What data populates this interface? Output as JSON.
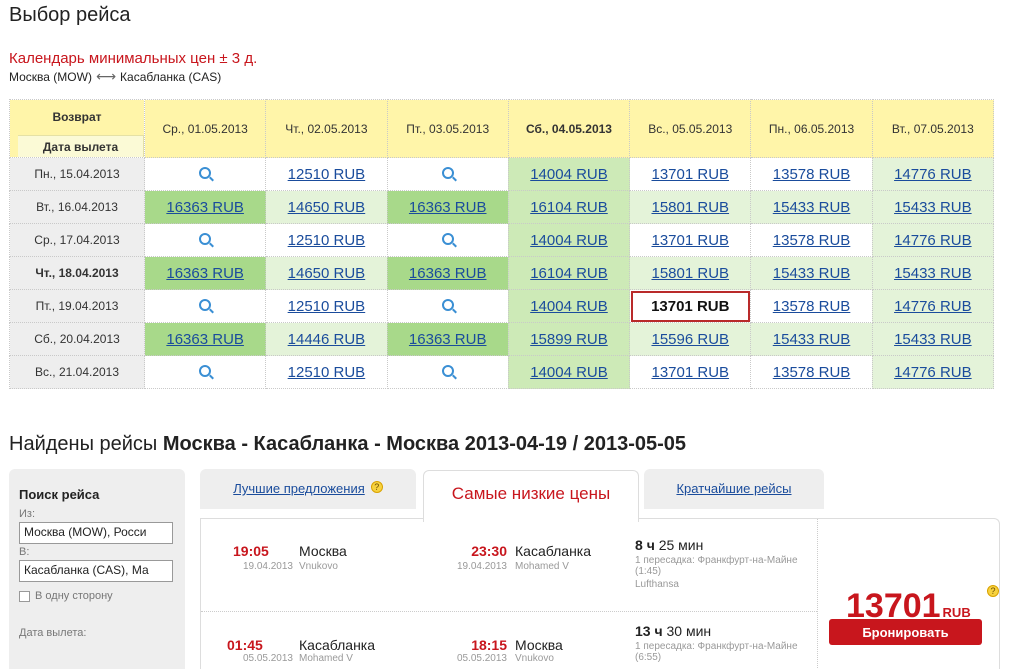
{
  "page_title": "Выбор рейса",
  "calendar": {
    "title": "Календарь минимальных цен ± 3 д.",
    "origin": "Москва (MOW)",
    "destination": "Касабланка (CAS)",
    "return_label": "Возврат",
    "departure_label": "Дата вылета",
    "return_dates": [
      "Ср., 01.05.2013",
      "Чт., 02.05.2013",
      "Пт., 03.05.2013",
      "Сб., 04.05.2013",
      "Вс., 05.05.2013",
      "Пн., 06.05.2013",
      "Вт., 07.05.2013"
    ],
    "rows": [
      {
        "date": "Пн., 15.04.2013",
        "cells": [
          "",
          "12510 RUB",
          "",
          "14004 RUB",
          "13701 RUB",
          "13578 RUB",
          "14776 RUB"
        ]
      },
      {
        "date": "Вт., 16.04.2013",
        "cells": [
          "16363 RUB",
          "14650 RUB",
          "16363 RUB",
          "16104 RUB",
          "15801 RUB",
          "15433 RUB",
          "15433 RUB"
        ]
      },
      {
        "date": "Ср., 17.04.2013",
        "cells": [
          "",
          "12510 RUB",
          "",
          "14004 RUB",
          "13701 RUB",
          "13578 RUB",
          "14776 RUB"
        ]
      },
      {
        "date": "Чт., 18.04.2013",
        "cells": [
          "16363 RUB",
          "14650 RUB",
          "16363 RUB",
          "16104 RUB",
          "15801 RUB",
          "15433 RUB",
          "15433 RUB"
        ]
      },
      {
        "date": "Пт., 19.04.2013",
        "cells": [
          "",
          "12510 RUB",
          "",
          "14004 RUB",
          "13701 RUB",
          "13578 RUB",
          "14776 RUB"
        ]
      },
      {
        "date": "Сб., 20.04.2013",
        "cells": [
          "16363 RUB",
          "14446 RUB",
          "16363 RUB",
          "15899 RUB",
          "15596 RUB",
          "15433 RUB",
          "15433 RUB"
        ]
      },
      {
        "date": "Вс., 21.04.2013",
        "cells": [
          "",
          "12510 RUB",
          "",
          "14004 RUB",
          "13701 RUB",
          "13578 RUB",
          "14776 RUB"
        ]
      }
    ]
  },
  "found": {
    "prefix": "Найдены рейсы",
    "route": "Москва - Касабланка - Москва 2013-04-19 / 2013-05-05"
  },
  "search": {
    "title": "Поиск рейса",
    "from_label": "Из:",
    "from_value": "Москва (MOW), Росси",
    "to_label": "В:",
    "to_value": "Касабланка (CAS), Ма",
    "one_way_label": "В одну сторону",
    "departure_label": "Дата вылета:"
  },
  "tabs": {
    "best": "Лучшие предложения",
    "cheapest": "Самые низкие цены",
    "shortest": "Кратчайшие рейсы"
  },
  "result": {
    "outbound": {
      "dep_time": "19:05",
      "dep_city": "Москва",
      "dep_date": "19.04.2013",
      "dep_airport": "Vnukovo",
      "arr_time": "23:30",
      "arr_city": "Касабланка",
      "arr_date": "19.04.2013",
      "arr_airport": "Mohamed V",
      "dur_h": "8",
      "dur_h_unit": "ч",
      "dur_m": "25 мин",
      "transfer": "1 пересадка: Франкфурт-на-Майне (1:45)",
      "airline": "Lufthansa"
    },
    "inbound": {
      "dep_time": "01:45",
      "dep_city": "Касабланка",
      "dep_date": "05.05.2013",
      "dep_airport": "Mohamed V",
      "arr_time": "18:15",
      "arr_city": "Москва",
      "arr_date": "05.05.2013",
      "arr_airport": "Vnukovo",
      "dur_h": "13",
      "dur_h_unit": "ч",
      "dur_m": "30 мин",
      "transfer": "1 пересадка: Франкфурт-на-Майне (6:55)"
    },
    "price": "13701",
    "currency": "RUB",
    "book_label": "Бронировать"
  },
  "colors": {
    "accent": "#c8161d",
    "link": "#1a4c9c",
    "header": "#fff5a9"
  }
}
